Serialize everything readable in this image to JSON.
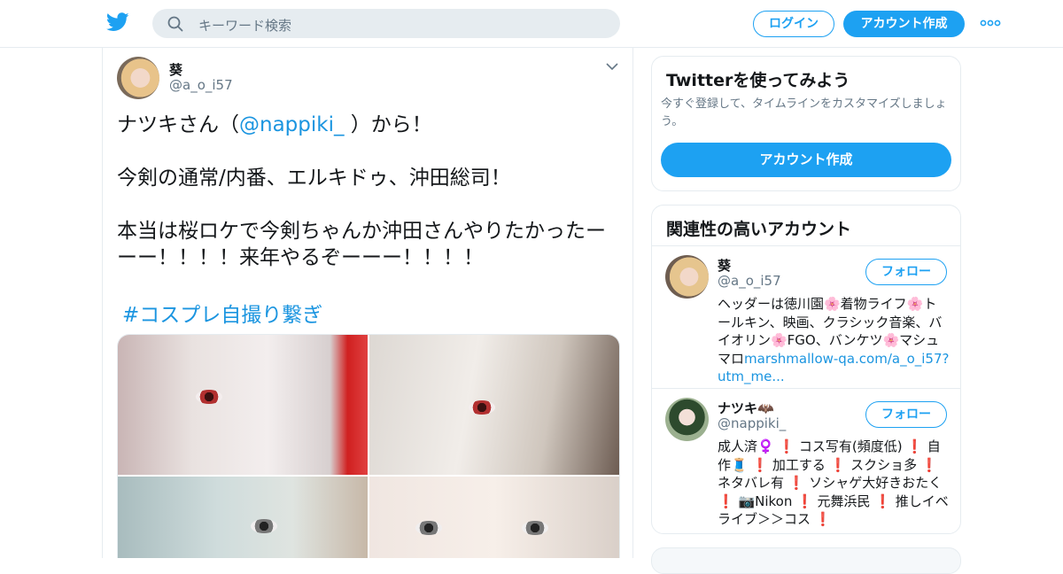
{
  "header": {
    "logo_icon": "twitter-bird-icon",
    "search_placeholder": "キーワード検索",
    "login_label": "ログイン",
    "signup_label": "アカウント作成",
    "more_icon": "more-dots-icon",
    "brand_color": "#1da1f2"
  },
  "tweet": {
    "author_name": "葵",
    "author_handle": "@a_o_i57",
    "text_intro": "ナツキさん（",
    "mention": "@nappiki_",
    "text_intro_end": " ）から！",
    "line2": "今剣の通常/内番、エルキドゥ、沖田総司！",
    "line3": "本当は桜ロケで今剣ちゃんか沖田さんやりたかったーーー！！！！来年やるぞーーー！！！！",
    "hashtag": "#コスプレ自撮り繋ぎ",
    "media_count": 4
  },
  "sidebar": {
    "signup_card": {
      "title": "Twitterを使ってみよう",
      "description": "今すぐ登録して、タイムラインをカスタマイズしましょう。",
      "button_label": "アカウント作成"
    },
    "related": {
      "title": "関連性の高いアカウント",
      "accounts": [
        {
          "name": "葵",
          "handle": "@a_o_i57",
          "follow_label": "フォロー",
          "bio": "ヘッダーは徳川園🌸着物ライフ🌸トールキン、映画、クラシック音楽、バイオリン🌸FGO、バンケツ🌸マシュマロ",
          "bio_link": "marshmallow-qa.com/a_o_i57?utm_me..."
        },
        {
          "name": "ナツキ🦇",
          "handle": "@nappiki_",
          "follow_label": "フォロー",
          "bio": "成人済♀️ ❗️ コス写有(頻度低) ❗️ 自作🧵 ❗️ 加工する ❗️ スクショ多 ❗️ ネタバレ有 ❗️ ソシャゲ大好きおたく ❗️ 📷Nikon ❗️ 元舞浜民 ❗️ 推しイベライブ＞＞コス ❗️"
        }
      ]
    }
  }
}
